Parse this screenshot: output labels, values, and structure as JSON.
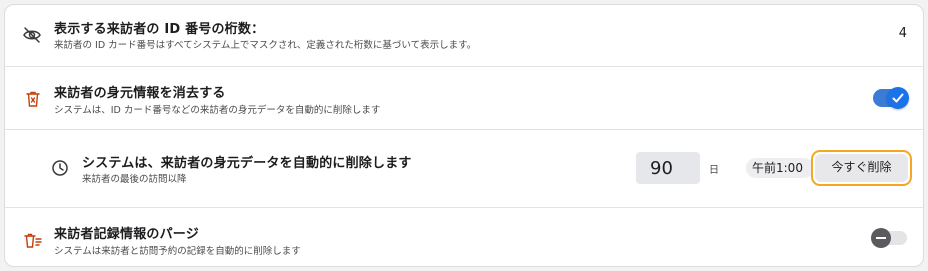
{
  "rows": [
    {
      "title": "表示する来訪者の ID 番号の桁数：",
      "description": "来訪者の ID カード番号はすべてシステム上でマスクされ、定義された桁数に基づいて表示します。",
      "value": "4",
      "icon": "eye-off-icon"
    },
    {
      "title": "来訪者の身元情報を消去する",
      "description": "システムは、ID カード番号などの来訪者の身元データを自動的に削除します",
      "toggle": "on",
      "icon": "trash-x-icon"
    },
    {
      "title": "システムは、来訪者の身元データを自動的に削除します",
      "description": "来訪者の最後の訪問以降",
      "days_value": "90",
      "days_unit": "日",
      "time_value": "午前1:00",
      "delete_button_label": "今すぐ削除",
      "icon": "clock-icon"
    },
    {
      "title": "来訪者記録情報のパージ",
      "description": "システムは来訪者と訪問予約の記録を自動的に削除します",
      "toggle": "off",
      "icon": "trash-list-icon"
    }
  ],
  "colors": {
    "accent": "#1a73e8",
    "focus_ring": "#f5a623",
    "icon_orange": "#c2410c"
  }
}
